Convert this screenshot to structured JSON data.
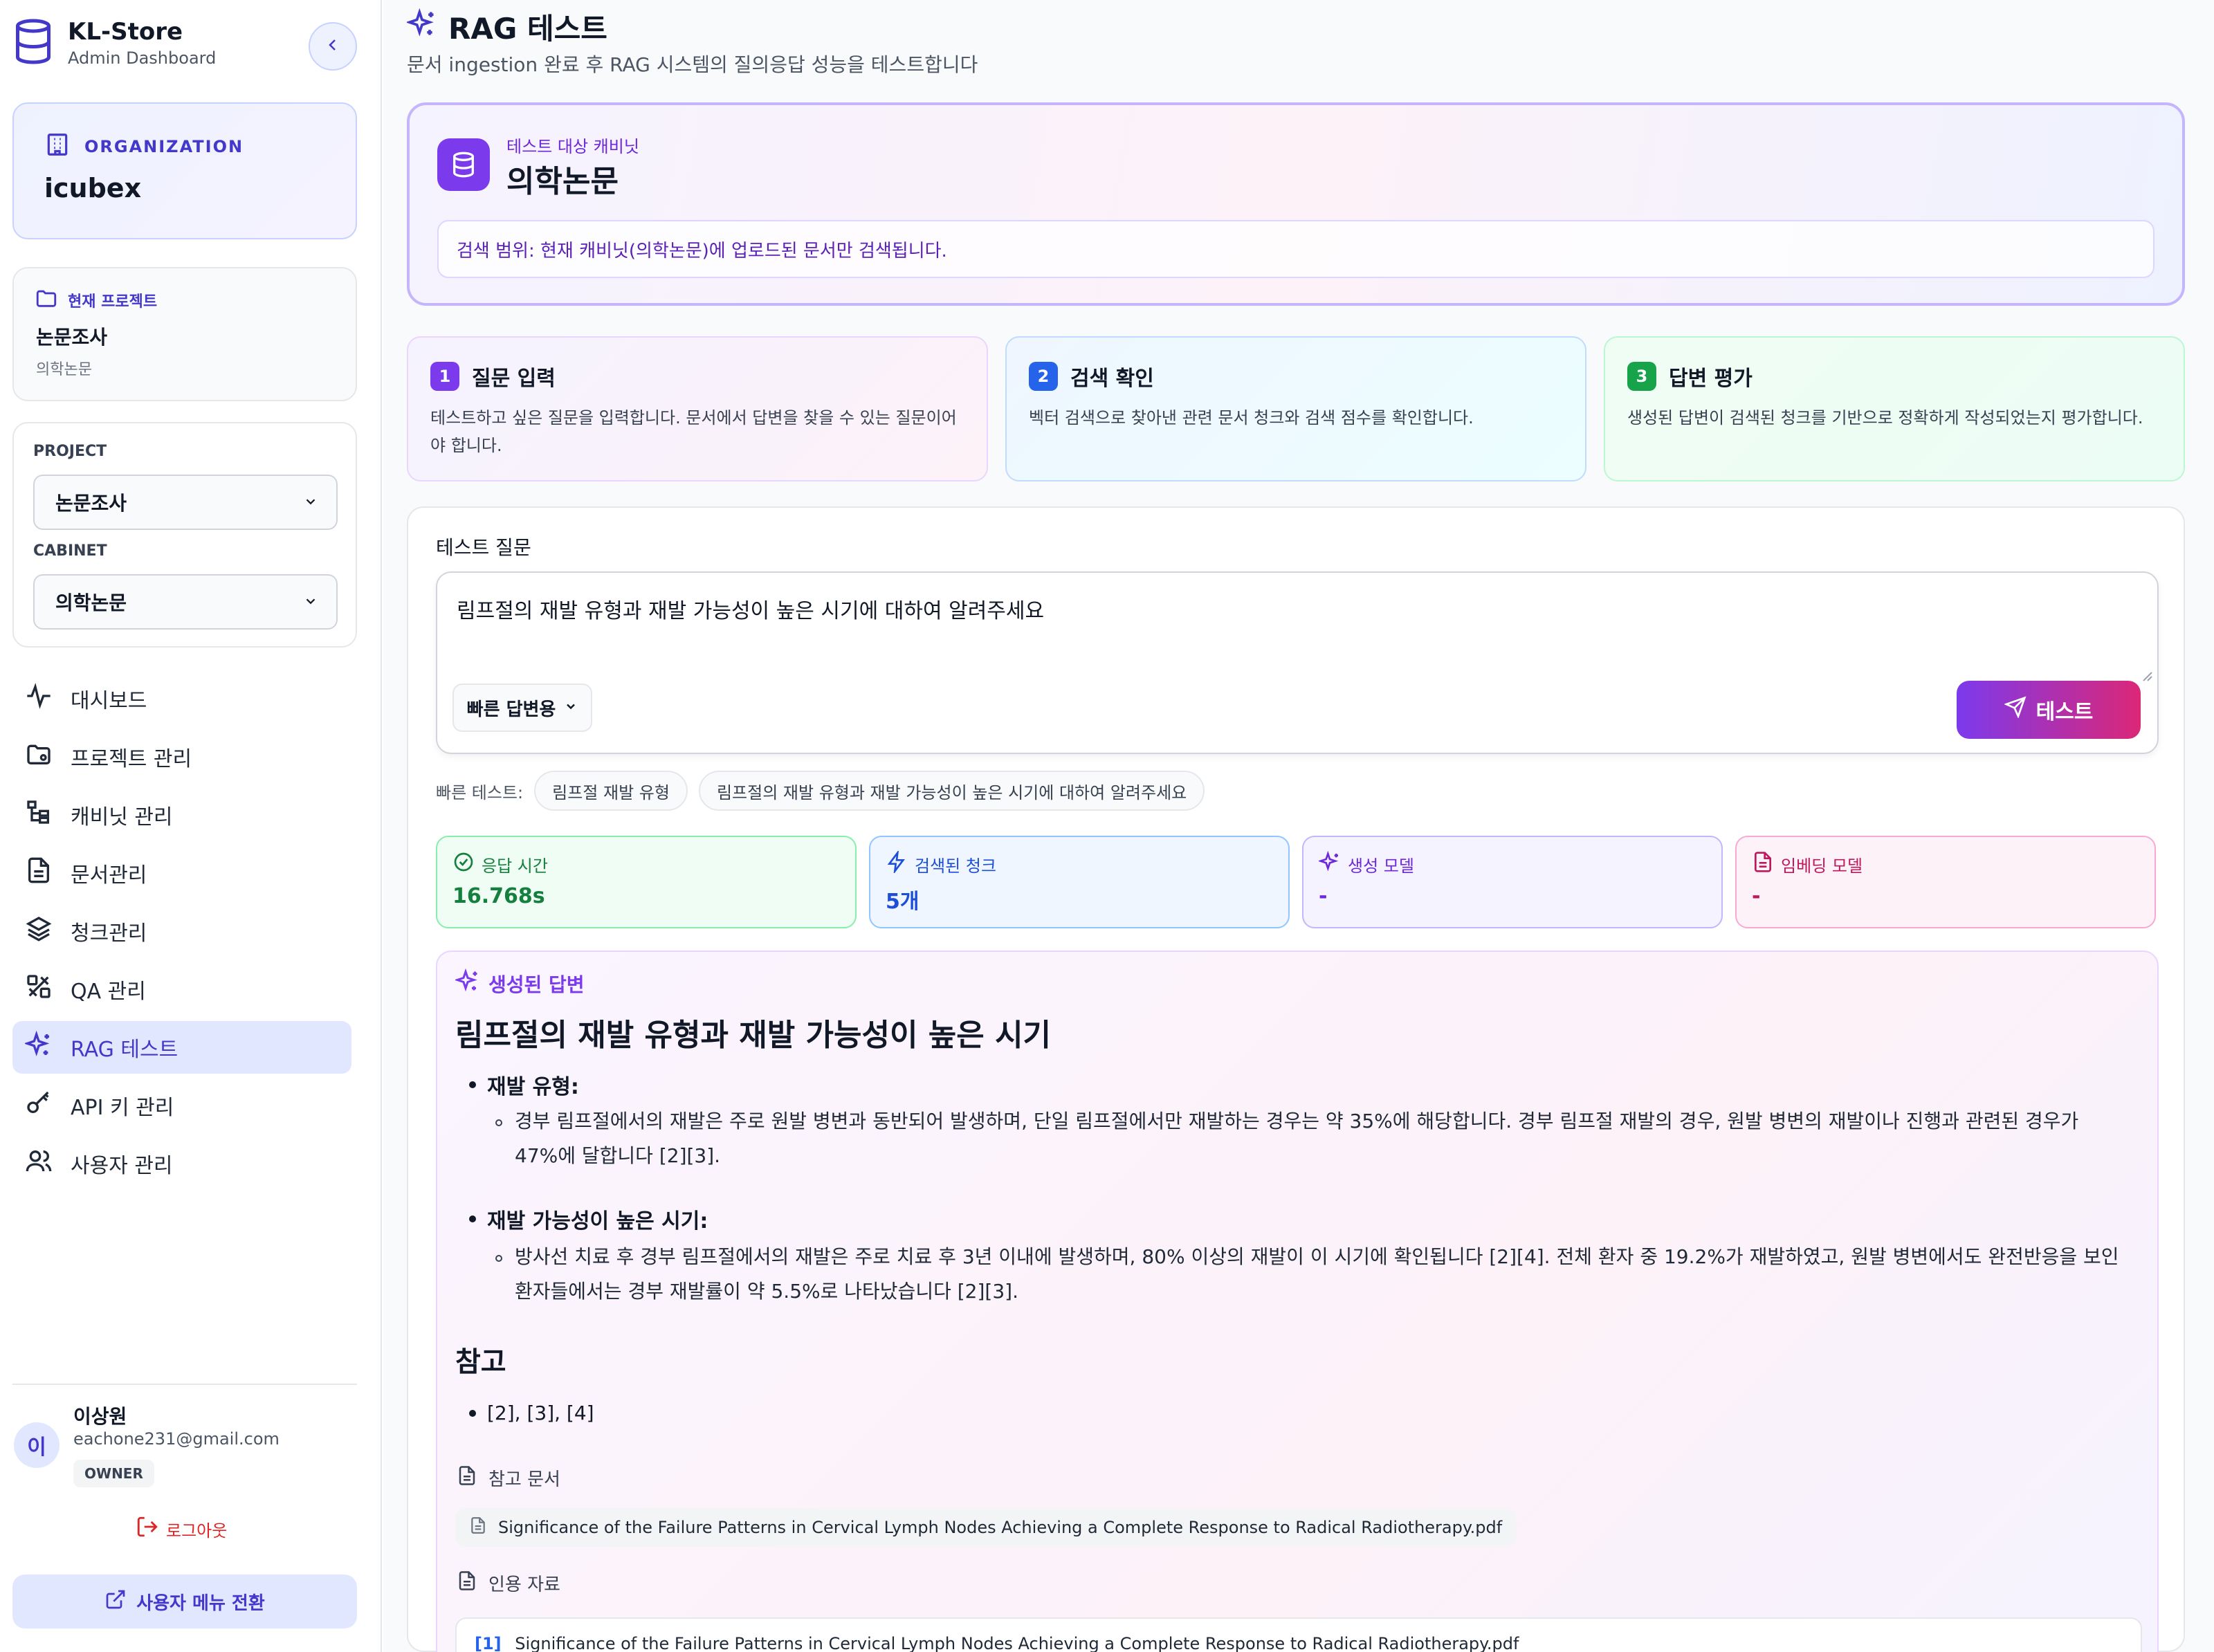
{
  "brand": {
    "title": "KL-Store",
    "subtitle": "Admin Dashboard"
  },
  "organization": {
    "label": "ORGANIZATION",
    "name": "icubex"
  },
  "current_project": {
    "label": "현재 프로젝트",
    "name": "논문조사",
    "cabinet": "의학논문"
  },
  "selectors": {
    "project_label": "PROJECT",
    "project_value": "논문조사",
    "cabinet_label": "CABINET",
    "cabinet_value": "의학논문"
  },
  "nav": [
    {
      "label": "대시보드",
      "icon": "activity-icon"
    },
    {
      "label": "프로젝트 관리",
      "icon": "folder-icon"
    },
    {
      "label": "캐비닛 관리",
      "icon": "tree-icon"
    },
    {
      "label": "문서관리",
      "icon": "document-icon"
    },
    {
      "label": "청크관리",
      "icon": "layers-icon"
    },
    {
      "label": "QA 관리",
      "icon": "tools-icon"
    },
    {
      "label": "RAG 테스트",
      "icon": "sparkles-icon",
      "active": true
    },
    {
      "label": "API 키 관리",
      "icon": "key-icon"
    },
    {
      "label": "사용자 관리",
      "icon": "users-icon"
    }
  ],
  "user": {
    "avatar": "이",
    "name": "이상원",
    "email": "eachone231@gmail.com",
    "role": "OWNER"
  },
  "logout_label": "로그아웃",
  "switch_label": "사용자 메뉴 전환",
  "page": {
    "title": "RAG 테스트",
    "subtitle": "문서 ingestion 완료 후 RAG 시스템의 질의응답 성능을 테스트합니다"
  },
  "target": {
    "label": "테스트 대상 캐비닛",
    "name": "의학논문",
    "scope": "검색 범위: 현재 캐비닛(의학논문)에 업로드된 문서만 검색됩니다."
  },
  "steps": [
    {
      "num": "1",
      "title": "질문 입력",
      "desc": "테스트하고 싶은 질문을 입력합니다. 문서에서 답변을 찾을 수 있는 질문이어야 합니다.",
      "color": "#7c3aed"
    },
    {
      "num": "2",
      "title": "검색 확인",
      "desc": "벡터 검색으로 찾아낸 관련 문서 청크와 검색 점수를 확인합니다.",
      "color": "#2563eb"
    },
    {
      "num": "3",
      "title": "답변 평가",
      "desc": "생성된 답변이 검색된 청크를 기반으로 정확하게 작성되었는지 평가합니다.",
      "color": "#16a34a"
    }
  ],
  "question": {
    "label": "테스트 질문",
    "value": "림프절의 재발 유형과 재발 가능성이 높은 시기에 대하여 알려주세요",
    "model_option": "빠른 답변용",
    "submit_label": "테스트"
  },
  "quick_tests": {
    "label": "빠른 테스트:",
    "items": [
      "림프절 재발 유형",
      "림프절의 재발 유형과 재발 가능성이 높은 시기에 대하여 알려주세요"
    ]
  },
  "metrics": [
    {
      "label": "응답 시간",
      "value": "16.768s"
    },
    {
      "label": "검색된 청크",
      "value": "5개"
    },
    {
      "label": "생성 모델",
      "value": "-"
    },
    {
      "label": "임베딩 모델",
      "value": "-"
    }
  ],
  "answer": {
    "label": "생성된 답변",
    "title": "림프절의 재발 유형과 재발 가능성이 높은 시기",
    "bullet1": "재발 유형:",
    "bullet1_line1": "경부 림프절에서의 재발은 주로 원발 병변과 동반되어 발생하며, 단일 림프절에서만 재발하는 경우는 약 35%에 해당합니다. 경부 림프절 재발의 경우, 원발 병변의 재발이나 진행과 관련된 경우가",
    "bullet1_line2": "47%에 달합니다 [2][3].",
    "bullet2": "재발 가능성이 높은 시기:",
    "bullet2_line1": "방사선 치료 후 경부 림프절에서의 재발은 주로 치료 후 3년 이내에 발생하며, 80% 이상의 재발이 이 시기에 확인됩니다 [2][4]. 전체 환자 중 19.2%가 재발하였고, 원발 병변에서도 완전반응을 보인",
    "bullet2_line2": "환자들에서는 경부 재발률이 약 5.5%로 나타났습니다 [2][3].",
    "ref_title": "참고",
    "ref_items": "[2], [3], [4]",
    "docs_label": "참고 문서",
    "doc_name": "Significance of the Failure Patterns in Cervical Lymph Nodes Achieving a Complete Response to Radical Radiotherapy.pdf",
    "cite_label": "인용 자료",
    "cite_num": "[1]",
    "cite_text": "Significance of the Failure Patterns in Cervical Lymph Nodes Achieving a Complete Response to Radical Radiotherapy.pdf"
  }
}
